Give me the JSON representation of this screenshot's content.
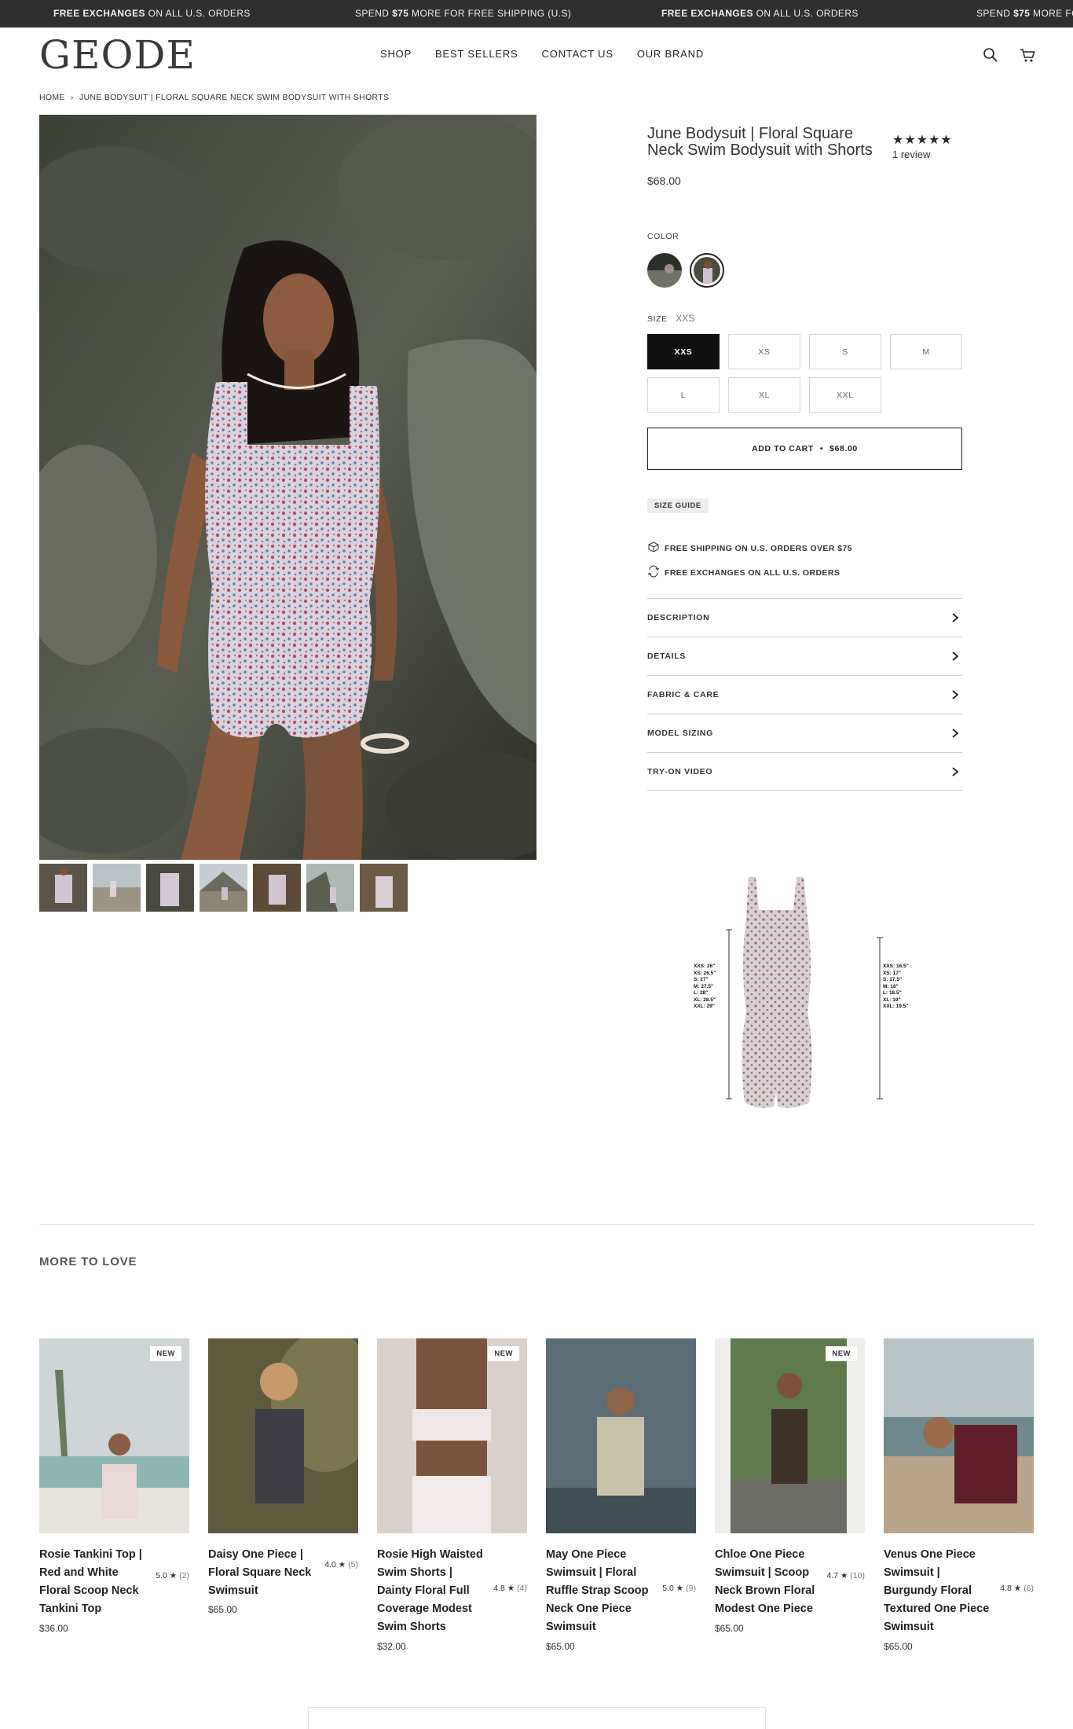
{
  "announcement": {
    "items": [
      {
        "bold": "FREE EXCHANGES",
        "rest": " ON ALL U.S. ORDERS"
      },
      {
        "pre": "SPEND ",
        "bold": "$75",
        "rest": " MORE FOR FREE SHIPPING (U.S)"
      },
      {
        "bold": "FREE EXCHANGES",
        "rest": " ON ALL U.S. ORDERS"
      },
      {
        "pre": "SPEND ",
        "bold": "$75",
        "rest": " MORE FO"
      }
    ]
  },
  "header": {
    "logo": "GEODE",
    "nav": [
      "SHOP",
      "BEST SELLERS",
      "CONTACT US",
      "OUR BRAND"
    ],
    "icons": [
      "search-icon",
      "cart-icon"
    ]
  },
  "breadcrumb": {
    "home": "HOME",
    "separator": "›",
    "current": "JUNE BODYSUIT | FLORAL SQUARE NECK SWIM BODYSUIT WITH SHORTS"
  },
  "product": {
    "title": "June Bodysuit | Floral Square Neck Swim Bodysuit with Shorts",
    "rating": 5,
    "stars": "★★★★★",
    "reviews": "1 review",
    "price": "$68.00",
    "color_label": "COLOR",
    "size_label": "SIZE",
    "selected_size": "XXS",
    "sizes": [
      "XXS",
      "XS",
      "S",
      "M",
      "L",
      "XL",
      "XXL"
    ],
    "add_to_cart": "ADD TO CART",
    "add_to_cart_dot": "•",
    "add_to_cart_price": "$68.00",
    "size_guide": "SIZE GUIDE",
    "perks": [
      {
        "icon": "box-icon",
        "text": "FREE SHIPPING ON U.S. ORDERS OVER $75"
      },
      {
        "icon": "exchange-icon",
        "text": "FREE EXCHANGES ON ALL U.S. ORDERS"
      }
    ],
    "accordions": [
      "DESCRIPTION",
      "DETAILS",
      "FABRIC & CARE",
      "MODEL SIZING",
      "TRY-ON VIDEO"
    ],
    "thumbnail_count": 7
  },
  "size_chart": {
    "left_measurements": [
      "XXS: 26\"",
      "XS: 26.5\"",
      "S: 27\"",
      "M: 27.5\"",
      "L: 28\"",
      "XL: 28.5\"",
      "XXL: 29\""
    ],
    "right_measurements": [
      "XXS: 16.5\"",
      "XS: 17\"",
      "S: 17.5\"",
      "M: 18\"",
      "L: 18.5\"",
      "XL: 19\"",
      "XXL: 19.5\""
    ]
  },
  "more_to_love": {
    "title": "MORE TO LOVE",
    "products": [
      {
        "name": "Rosie Tankini Top | Red and White Floral Scoop Neck Tankini Top",
        "rating": "5.0 ★",
        "count": "(2)",
        "price": "$36.00",
        "badge": "NEW"
      },
      {
        "name": "Daisy One Piece | Floral Square Neck Swimsuit",
        "rating": "4.0 ★",
        "count": "(5)",
        "price": "$65.00",
        "badge": ""
      },
      {
        "name": "Rosie High Waisted Swim Shorts | Dainty Floral Full Coverage Modest Swim Shorts",
        "rating": "4.8 ★",
        "count": "(4)",
        "price": "$32.00",
        "badge": "NEW"
      },
      {
        "name": "May One Piece Swimsuit | Floral Ruffle Strap Scoop Neck One Piece Swimsuit",
        "rating": "5.0 ★",
        "count": "(9)",
        "price": "$65.00",
        "badge": ""
      },
      {
        "name": "Chloe One Piece Swimsuit | Scoop Neck Brown Floral Modest One Piece",
        "rating": "4.7 ★",
        "count": "(10)",
        "price": "$65.00",
        "badge": "NEW"
      },
      {
        "name": "Venus One Piece Swimsuit | Burgundy Floral Textured One Piece Swimsuit",
        "rating": "4.8 ★",
        "count": "(6)",
        "price": "$65.00",
        "badge": ""
      }
    ]
  },
  "colors": {
    "topbar": "#2f2f2f",
    "selected_size_bg": "#0f0f0f",
    "border": "#d5d5d5"
  }
}
